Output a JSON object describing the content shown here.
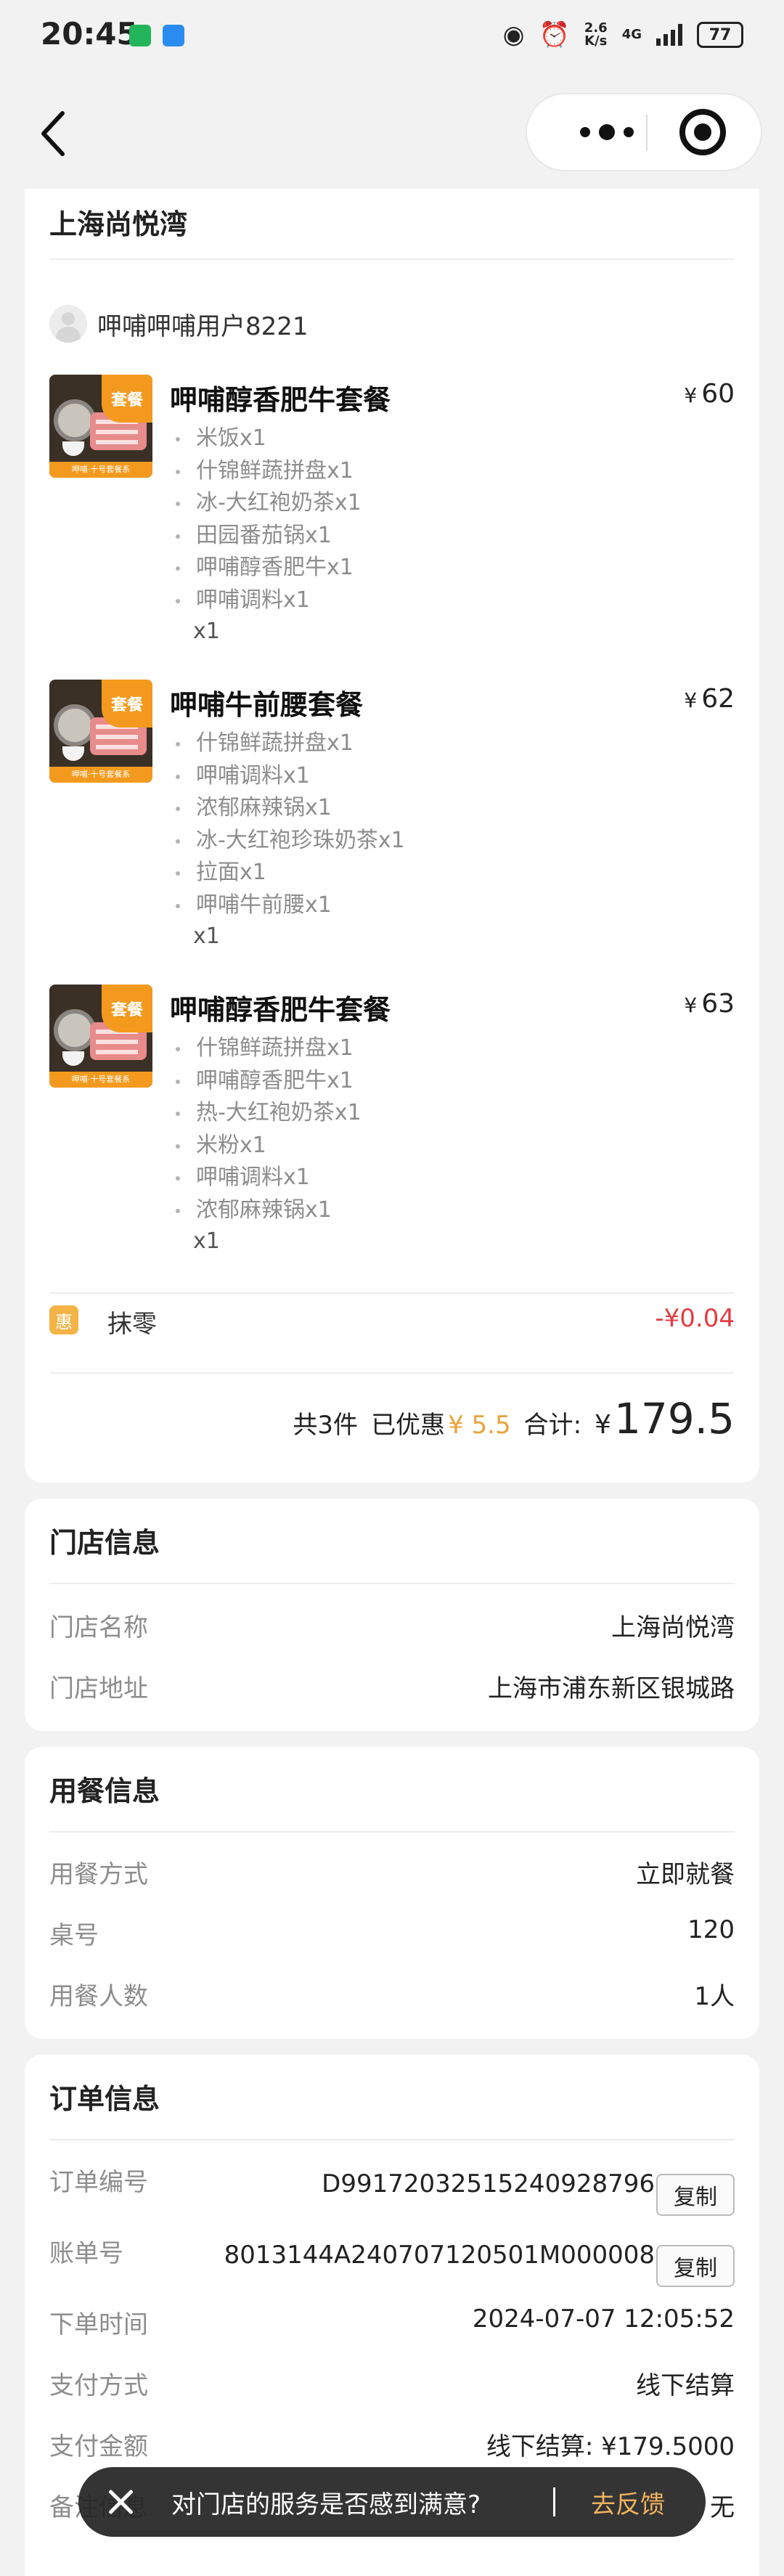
{
  "status_bar": {
    "time": "20:45",
    "net_speed_top": "2.6",
    "net_speed_bottom": "K/s",
    "signal": "4G",
    "battery": "77"
  },
  "store_name": "上海尚悦湾",
  "user_name": "呷哺呷哺用户8221",
  "currency_symbol": "¥",
  "thumb": {
    "tag": "套餐",
    "strip": "呷哺·十号套餐系"
  },
  "items": [
    {
      "name": "呷哺醇香肥牛套餐",
      "price": "60",
      "qty": "x1",
      "subs": [
        "米饭x1",
        "什锦鲜蔬拼盘x1",
        "冰-大红袍奶茶x1",
        "田园番茄锅x1",
        "呷哺醇香肥牛x1",
        "呷哺调料x1"
      ]
    },
    {
      "name": "呷哺牛前腰套餐",
      "price": "62",
      "qty": "x1",
      "subs": [
        "什锦鲜蔬拼盘x1",
        "呷哺调料x1",
        "浓郁麻辣锅x1",
        "冰-大红袍珍珠奶茶x1",
        "拉面x1",
        "呷哺牛前腰x1"
      ]
    },
    {
      "name": "呷哺醇香肥牛套餐",
      "price": "63",
      "qty": "x1",
      "subs": [
        "什锦鲜蔬拼盘x1",
        "呷哺醇香肥牛x1",
        "热-大红袍奶茶x1",
        "米粉x1",
        "呷哺调料x1",
        "浓郁麻辣锅x1"
      ]
    }
  ],
  "discount": {
    "badge": "惠",
    "name": "抹零",
    "value": "-¥0.04"
  },
  "summary": {
    "count": "共3件",
    "saved_label": "已优惠",
    "saved_value": "¥ 5.5",
    "total_label": "合计:",
    "total_yen": "¥",
    "total_value": "179.5"
  },
  "store_info": {
    "title": "门店信息",
    "name_label": "门店名称",
    "name_value": "上海尚悦湾",
    "addr_label": "门店地址",
    "addr_value": "上海市浦东新区银城路"
  },
  "dining_info": {
    "title": "用餐信息",
    "mode_label": "用餐方式",
    "mode_value": "立即就餐",
    "table_label": "桌号",
    "table_value": "120",
    "people_label": "用餐人数",
    "people_value": "1人"
  },
  "order_info": {
    "title": "订单信息",
    "order_no_label": "订单编号",
    "order_no_value": "D99172032515240928796",
    "bill_no_label": "账单号",
    "bill_no_value": "8013144A240707120501M000008",
    "copy_label": "复制",
    "time_label": "下单时间",
    "time_value": "2024-07-07 12:05:52",
    "pay_method_label": "支付方式",
    "pay_method_value": "线下结算",
    "pay_amount_label": "支付金额",
    "pay_amount_value": "线下结算: ¥179.5000",
    "remark_label": "备注信息",
    "remark_value": "无"
  },
  "toast": {
    "text": "对门店的服务是否感到满意?",
    "action": "去反馈"
  },
  "colors": {
    "accent_orange": "#f39a1e",
    "discount_red": "#e53b42",
    "saved_orange": "#e8a33a",
    "badge_yellow": "#f4b347"
  }
}
